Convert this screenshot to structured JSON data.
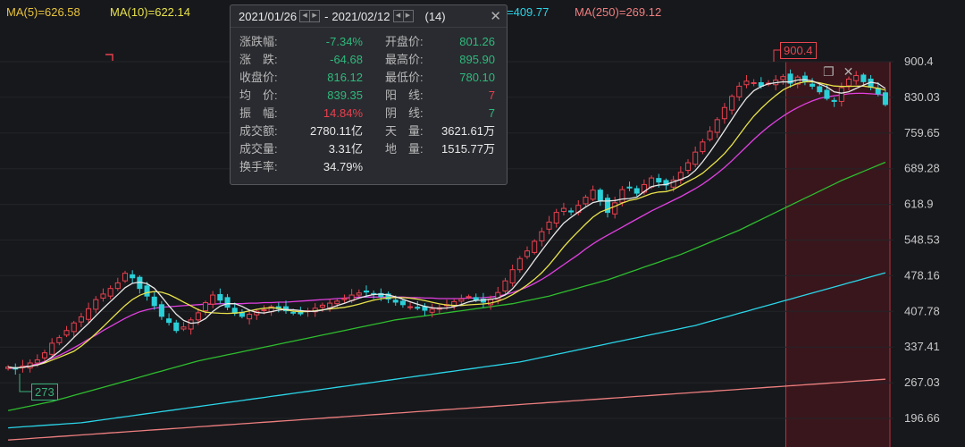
{
  "ma_legend": [
    {
      "text": "MA(5)=626.58",
      "color": "#e8c33b",
      "left": 7
    },
    {
      "text": "MA(10)=622.14",
      "color": "#e8e24b",
      "left": 123
    },
    {
      "text": "=409.77",
      "color": "#2ad5e8",
      "left": 567
    },
    {
      "text": "MA(250)=269.12",
      "color": "#ee7f7f",
      "left": 643
    }
  ],
  "popup": {
    "date_start": "2021/01/26",
    "date_end": "2021/02/12",
    "date_sep": "-",
    "count": "(14)",
    "close_icon": "close-icon",
    "rows": [
      {
        "l_label": "涨跌幅:",
        "l_value": "-7.34%",
        "l_color": "green",
        "r_label": "开盘价:",
        "r_value": "801.26",
        "r_color": "green"
      },
      {
        "l_label": "涨　跌:",
        "l_value": "-64.68",
        "l_color": "green",
        "r_label": "最高价:",
        "r_value": "895.90",
        "r_color": "green"
      },
      {
        "l_label": "收盘价:",
        "l_value": "816.12",
        "l_color": "green",
        "r_label": "最低价:",
        "r_value": "780.10",
        "r_color": "green"
      },
      {
        "l_label": "均　价:",
        "l_value": "839.35",
        "l_color": "green",
        "r_label": "阳　线:",
        "r_value": "7",
        "r_color": "red"
      },
      {
        "l_label": "振　幅:",
        "l_value": "14.84%",
        "l_color": "red",
        "r_label": "阴　线:",
        "r_value": "7",
        "r_color": "green"
      },
      {
        "l_label": "成交额:",
        "l_value": "2780.11亿",
        "l_color": "white",
        "r_label": "天　量:",
        "r_value": "3621.61万",
        "r_color": "white"
      },
      {
        "l_label": "成交量:",
        "l_value": "3.31亿",
        "l_color": "white",
        "r_label": "地　量:",
        "r_value": "1515.77万",
        "r_color": "white"
      },
      {
        "l_label": "换手率:",
        "l_value": "34.79%",
        "l_color": "white",
        "r_label": "",
        "r_value": "",
        "r_color": "white"
      }
    ]
  },
  "flags": {
    "high": "900.4",
    "low": "273"
  },
  "chart_data": {
    "type": "candlestick",
    "y_ticks": [
      "900.4",
      "830.03",
      "759.65",
      "689.28",
      "618.9",
      "548.53",
      "478.16",
      "407.78",
      "337.41",
      "267.03",
      "196.66"
    ],
    "y_tick_values": [
      900.4,
      830.03,
      759.65,
      689.28,
      618.9,
      548.53,
      478.16,
      407.78,
      337.41,
      267.03,
      196.66
    ],
    "ylim": [
      168,
      975
    ],
    "n_bars": 121,
    "highlight_range": {
      "start_index": 107,
      "end_index": 120
    },
    "colors": {
      "up": "#e8404e",
      "down": "#2ad0d8",
      "ma5": "#e8e8e8",
      "ma10": "#e8e24b",
      "ma20": "#e040e0",
      "ma60": "#2ebd2e",
      "ma120": "#2ad5e8",
      "ma250": "#ee7f7f"
    },
    "closes": [
      298,
      294,
      300,
      306,
      312,
      326,
      345,
      356,
      370,
      385,
      397,
      413,
      431,
      442,
      453,
      464,
      483,
      474,
      453,
      438,
      419,
      398,
      386,
      370,
      377,
      391,
      405,
      425,
      440,
      430,
      416,
      404,
      398,
      402,
      408,
      411,
      417,
      413,
      409,
      405,
      403,
      409,
      414,
      420,
      424,
      428,
      433,
      440,
      444,
      446,
      442,
      437,
      432,
      426,
      421,
      417,
      414,
      410,
      412,
      415,
      421,
      427,
      432,
      437,
      430,
      426,
      432,
      445,
      468,
      490,
      512,
      527,
      546,
      565,
      584,
      603,
      611,
      604,
      617,
      633,
      647,
      627,
      603,
      622,
      648,
      652,
      641,
      658,
      671,
      663,
      657,
      667,
      682,
      701,
      722,
      742,
      763,
      786,
      810,
      832,
      852,
      862,
      859,
      852,
      858,
      864,
      871,
      858,
      870,
      861,
      852,
      841,
      828,
      822,
      849,
      866,
      873,
      861,
      850,
      837,
      816
    ],
    "ma20": [
      295,
      296,
      298,
      301,
      304,
      309,
      315,
      321,
      328,
      336,
      344,
      353,
      361,
      370,
      378,
      386,
      394,
      401,
      407,
      411,
      414,
      416,
      417,
      418,
      419,
      420,
      421,
      422,
      422,
      423,
      423,
      423,
      423,
      424,
      424,
      425,
      425,
      426,
      426,
      427,
      428,
      429,
      430,
      431,
      432,
      433,
      434,
      435,
      436,
      436,
      436,
      436,
      436,
      436,
      436,
      435,
      435,
      434,
      434,
      433,
      433,
      433,
      433,
      434,
      434,
      435,
      436,
      438,
      441,
      445,
      450,
      456,
      463,
      471,
      480,
      490,
      500,
      510,
      520,
      531,
      541,
      550,
      558,
      566,
      574,
      582,
      590,
      598,
      606,
      613,
      620,
      627,
      634,
      642,
      650,
      659,
      669,
      680,
      692,
      705,
      719,
      733,
      747,
      760,
      772,
      783,
      793,
      802,
      810,
      817,
      823,
      828,
      831,
      833,
      835,
      837,
      838,
      838,
      837,
      836,
      834
    ],
    "ma60": [
      212,
      215,
      218,
      221,
      224,
      227,
      230,
      234,
      238,
      242,
      246,
      250,
      254,
      258,
      262,
      266,
      270,
      274,
      278,
      282,
      286,
      290,
      294,
      298,
      302,
      306,
      310,
      313,
      316,
      319,
      322,
      325,
      328,
      331,
      334,
      337,
      340,
      343,
      346,
      349,
      352,
      355,
      358,
      361,
      364,
      367,
      370,
      373,
      376,
      379,
      382,
      385,
      388,
      391,
      393,
      395,
      397,
      399,
      401,
      403,
      405,
      407,
      409,
      411,
      413,
      415,
      417,
      419,
      421,
      423,
      426,
      429,
      432,
      435,
      438,
      442,
      446,
      450,
      454,
      458,
      462,
      466,
      470,
      475,
      480,
      485,
      490,
      495,
      500,
      505,
      510,
      515,
      520,
      526,
      532,
      538,
      544,
      550,
      556,
      562,
      568,
      575,
      582,
      589,
      596,
      603,
      610,
      617,
      624,
      631,
      638,
      645,
      652,
      659,
      666,
      672,
      678,
      684,
      690,
      696,
      702
    ],
    "ma120": [
      178,
      179,
      180,
      181,
      182,
      183,
      184,
      185,
      186,
      187,
      188,
      190,
      192,
      194,
      196,
      198,
      200,
      202,
      204,
      206,
      208,
      210,
      212,
      214,
      216,
      218,
      220,
      222,
      224,
      226,
      228,
      230,
      232,
      234,
      236,
      238,
      240,
      242,
      244,
      246,
      248,
      250,
      252,
      254,
      256,
      258,
      260,
      262,
      264,
      266,
      268,
      270,
      272,
      274,
      276,
      278,
      280,
      282,
      284,
      286,
      288,
      290,
      292,
      294,
      296,
      298,
      300,
      302,
      304,
      306,
      308,
      311,
      314,
      317,
      320,
      323,
      326,
      329,
      332,
      335,
      338,
      341,
      344,
      347,
      350,
      353,
      356,
      359,
      362,
      365,
      368,
      371,
      374,
      377,
      380,
      384,
      388,
      392,
      396,
      400,
      404,
      408,
      412,
      416,
      420,
      424,
      428,
      432,
      436,
      440,
      444,
      448,
      452,
      456,
      460,
      464,
      468,
      472,
      476,
      480,
      484
    ],
    "ma250": [
      154,
      155,
      156,
      157,
      158,
      159,
      160,
      161,
      162,
      163,
      164,
      165,
      166,
      167,
      168,
      169,
      170,
      171,
      172,
      173,
      174,
      175,
      176,
      177,
      178,
      179,
      180,
      181,
      182,
      183,
      184,
      185,
      186,
      187,
      188,
      189,
      190,
      191,
      192,
      193,
      194,
      195,
      196,
      197,
      198,
      199,
      200,
      201,
      202,
      203,
      204,
      205,
      206,
      207,
      208,
      209,
      210,
      211,
      212,
      213,
      214,
      215,
      216,
      217,
      218,
      219,
      220,
      221,
      222,
      223,
      224,
      225,
      226,
      227,
      228,
      229,
      230,
      231,
      232,
      233,
      234,
      235,
      236,
      237,
      238,
      239,
      240,
      241,
      242,
      243,
      244,
      245,
      246,
      247,
      248,
      249,
      250,
      251,
      252,
      253,
      254,
      255,
      256,
      257,
      258,
      259,
      260,
      261,
      262,
      263,
      264,
      265,
      266,
      267,
      268,
      269,
      270,
      271,
      272,
      273,
      274
    ]
  }
}
